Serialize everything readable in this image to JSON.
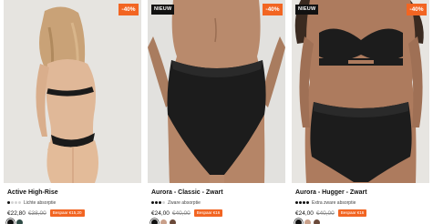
{
  "products": [
    {
      "name": "Active High-Rise",
      "badge_new": "",
      "discount": "-40%",
      "absorbency": {
        "level": 1,
        "max": 4,
        "label": "Lichte absorptie"
      },
      "price": "€22,80",
      "old_price": "€38,00",
      "savings": "Bespaar €15,20",
      "swatches": [
        "#111111",
        "#2f4b45"
      ]
    },
    {
      "name": "Aurora - Classic - Zwart",
      "badge_new": "NIEUW",
      "discount": "-40%",
      "absorbency": {
        "level": 3,
        "max": 4,
        "label": "Zware absorptie"
      },
      "price": "€24,00",
      "old_price": "€40,00",
      "savings": "Bespaar €16",
      "swatches": [
        "#111111",
        "#c9a08a",
        "#6b4a3a"
      ]
    },
    {
      "name": "Aurora - Hugger - Zwart",
      "badge_new": "NIEUW",
      "discount": "-40%",
      "absorbency": {
        "level": 4,
        "max": 4,
        "label": "Extra zware absorptie"
      },
      "price": "€24,00",
      "old_price": "€40,00",
      "savings": "Bespaar €16",
      "swatches": [
        "#111111",
        "#c9a08a",
        "#6b4a3a"
      ]
    }
  ],
  "colors": {
    "accent": "#f26522",
    "text": "#111111"
  }
}
